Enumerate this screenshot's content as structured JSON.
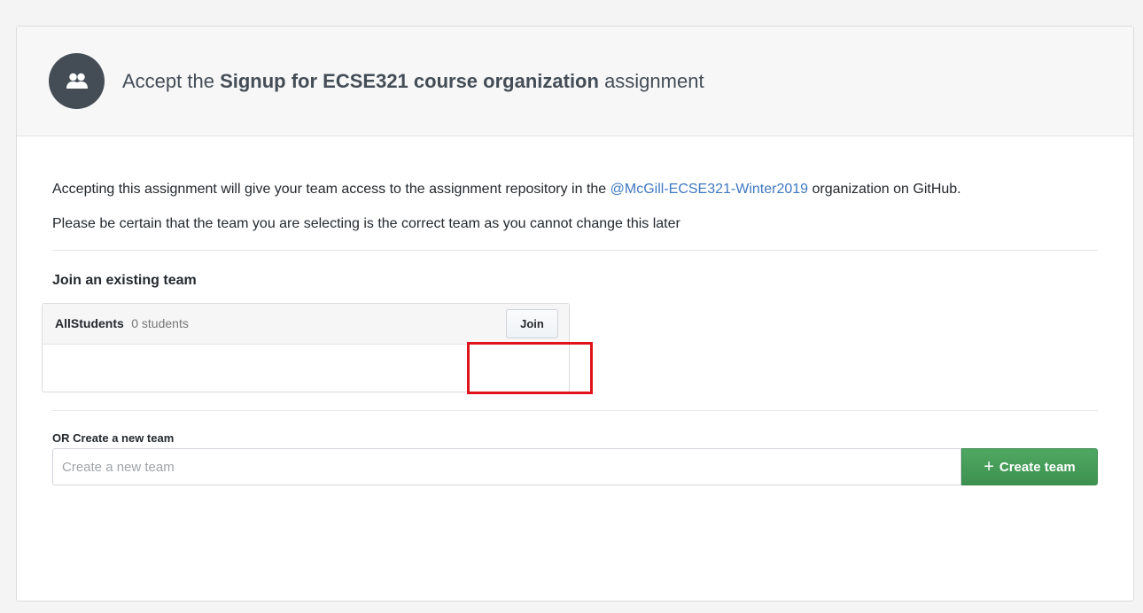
{
  "header": {
    "title_prefix": "Accept the",
    "title_bold": "Signup for ECSE321 course organization",
    "title_suffix": "assignment"
  },
  "body": {
    "desc_before_link": "Accepting this assignment will give your team access to the assignment repository in the",
    "org_link": "@McGill-ECSE321-Winter2019",
    "desc_after_link": "organization on GitHub.",
    "warning": "Please be certain that the team you are selecting is the correct team as you cannot change this later"
  },
  "join_section": {
    "title": "Join an existing team",
    "teams": [
      {
        "name": "AllStudents",
        "count": "0 students",
        "button": "Join"
      }
    ]
  },
  "create_section": {
    "label": "OR Create a new team",
    "placeholder": "Create a new team",
    "value": "",
    "button": "Create team",
    "button_icon": "+"
  },
  "colors": {
    "link": "#4078c0",
    "create_button": "#45a058",
    "highlight": "#e0121b"
  }
}
